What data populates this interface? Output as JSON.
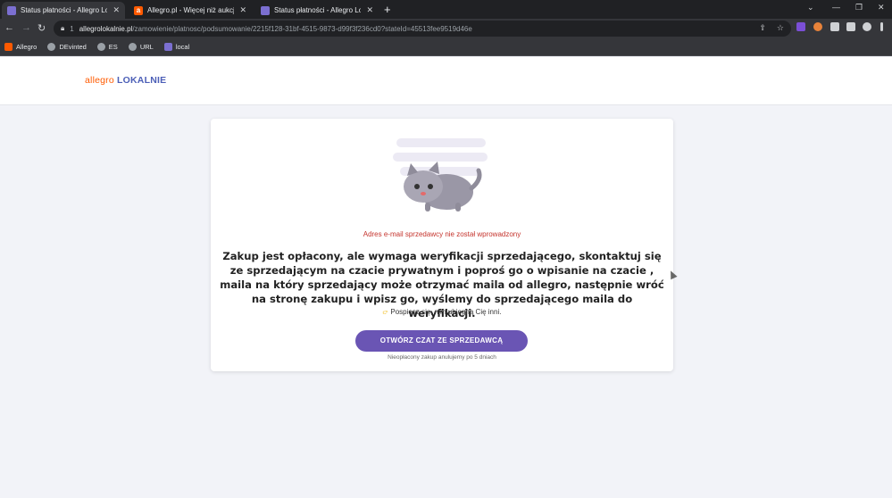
{
  "browser": {
    "tabs": [
      {
        "title": "Status płatności - Allegro Lokaln",
        "favicon": "allegro-lokalnie-favicon",
        "active": true
      },
      {
        "title": "Allegro.pl - Więcej niż aukcje. Na",
        "favicon": "allegro-favicon",
        "active": false
      },
      {
        "title": "Status płatności - Allegro Lokaln",
        "favicon": "allegro-lokalnie-favicon",
        "active": false
      }
    ],
    "new_tab_label": "+",
    "url_domain": "allegrolokalnie.pl",
    "url_path": "/zamowienie/platnosc/podsumowanie/2215f128-31bf-4515-9873-d99f3f236cd0?stateId=45513fee9519d46e",
    "url_prefix": "1",
    "bookmarks": [
      {
        "label": "Allegro",
        "icon": "allegro-favicon"
      },
      {
        "label": "DEvinted",
        "icon": "globe-icon"
      },
      {
        "label": "ES",
        "icon": "globe-icon"
      },
      {
        "label": "URL",
        "icon": "globe-icon"
      },
      {
        "label": "local",
        "icon": "allegro-lokalnie-favicon"
      }
    ]
  },
  "site": {
    "logo_part1": "allegro",
    "logo_part2": "LOKALNIE"
  },
  "card": {
    "error_text": "Adres e-mail sprzedawcy nie został wprowadzony",
    "message": "Zakup jest opłacony, ale wymaga weryfikacji sprzedającego, skontaktuj się ze sprzedającym na czacie prywatnym i poproś go o wpisanie na czacie , maila na który sprzedający może otrzymać maila od allegro, następnie wróć na stronę zakupu i wpisz go, wyślemy do sprzedającego maila do weryfikacji.",
    "hurry_text": "Pospiesz się, nim ubiegną Cię inni.",
    "cta_label": "OTWÓRZ CZAT ZE SPRZEDAWCĄ",
    "note": "Nieopłacony zakup anulujemy po 5 dniach"
  },
  "colors": {
    "accent": "#6a55b4",
    "error": "#c5342d",
    "brand_orange": "#ff5a00"
  }
}
